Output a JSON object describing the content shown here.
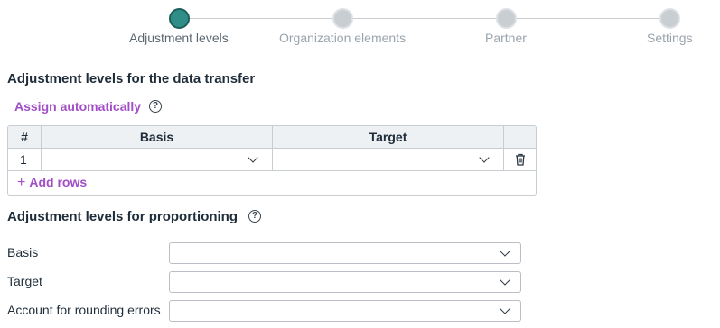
{
  "stepper": {
    "steps": [
      {
        "label": "Adjustment levels",
        "active": true
      },
      {
        "label": "Organization elements",
        "active": false
      },
      {
        "label": "Partner",
        "active": false
      },
      {
        "label": "Settings",
        "active": false
      }
    ]
  },
  "transfer": {
    "title": "Adjustment levels for the data transfer",
    "assign_label": "Assign automatically",
    "help_glyph": "?",
    "columns": {
      "index": "#",
      "basis": "Basis",
      "target": "Target"
    },
    "rows": [
      {
        "index": "1",
        "basis": "",
        "target": ""
      }
    ],
    "add_rows_label": "Add rows"
  },
  "proportioning": {
    "title": "Adjustment levels for proportioning",
    "help_glyph": "?",
    "fields": [
      {
        "label": "Basis",
        "value": ""
      },
      {
        "label": "Target",
        "value": ""
      },
      {
        "label": "Account for rounding errors",
        "value": ""
      }
    ]
  },
  "colors": {
    "accent": "#a24ec6",
    "step_active": "#2f8f88",
    "step_inactive": "#c9ced3"
  }
}
